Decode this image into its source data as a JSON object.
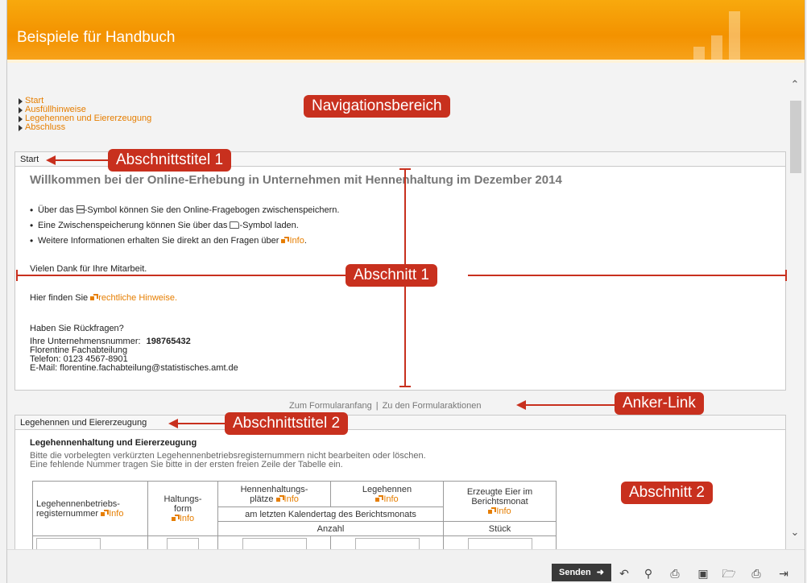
{
  "header": {
    "title": "Beispiele für Handbuch"
  },
  "nav": {
    "items": [
      "Start",
      "Ausfüllhinweise",
      "Legehennen und Eiererzeugung",
      "Abschluss"
    ]
  },
  "section1": {
    "heading": "Start",
    "welcome": "Willkommen bei der Online-Erhebung in Unternehmen mit Hennenhaltung im Dezember 2014",
    "bullet1_pre": "Über das ",
    "bullet1_post": "-Symbol können Sie den Online-Fragebogen zwischenspeichern.",
    "bullet2_pre": "Eine Zwischenspeicherung können Sie über das ",
    "bullet2_post": "-Symbol laden.",
    "bullet3_pre": "Weitere Informationen erhalten Sie direkt an den Fragen über ",
    "bullet3_link": "Info",
    "bullet3_post": ".",
    "thanks": "Vielen Dank für Ihre Mitarbeit.",
    "legal_pre": "Hier finden Sie ",
    "legal_link": "rechtliche Hinweise",
    "legal_post": ".",
    "questions": "Haben Sie Rückfragen?",
    "company_label": "Ihre Unternehmensnummer:",
    "company_number": "198765432",
    "contact_name": "Florentine Fachabteilung",
    "phone": "Telefon: 0123 4567-8901",
    "email": "E-Mail:   florentine.fachabteilung@statistisches.amt.de"
  },
  "anchors": {
    "top": "Zum Formularanfang",
    "separator": "|",
    "actions": "Zu den Formularaktionen"
  },
  "section2": {
    "heading": "Legehennen und Eiererzeugung",
    "title": "Legehennenhaltung und Eiererzeugung",
    "text_line1": "Bitte die vorbelegten verkürzten Legehennenbetriebsregisternummern nicht bearbeiten oder löschen.",
    "text_line2": "Eine fehlende Nummer tragen Sie bitte in der ersten freien Zeile der Tabelle ein.",
    "table": {
      "col1_line1": "Legehennenbetriebs-",
      "col1_line2": "registernummer",
      "col2_line1": "Haltungs-",
      "col2_line2": "form",
      "col3_line1": "Hennenhaltungs-",
      "col3_line2": "plätze",
      "col4": "Legehennen",
      "col5_line1": "Erzeugte Eier im",
      "col5_line2": "Berichtsmonat",
      "info": "Info",
      "subheader": "am letzten Kalendertag des Berichtsmonats",
      "unit_count": "Anzahl",
      "unit_pieces": "Stück"
    }
  },
  "annotations": {
    "nav": "Navigationsbereich",
    "title1": "Abschnittstitel 1",
    "section1": "Abschnitt 1",
    "anchor": "Anker-Link",
    "title2": "Abschnittstitel 2",
    "section2": "Abschnitt 2"
  },
  "toolbar": {
    "send_label": "Senden",
    "send_icon": "arrow-right-icon",
    "tools": [
      "undo-icon",
      "search-icon",
      "pdf-icon",
      "save-icon",
      "open-folder-icon",
      "print-icon",
      "exit-icon"
    ]
  },
  "colors": {
    "header": "#f39200",
    "accent": "#e67e00",
    "annotation": "#c8301e",
    "send_button": "#3a3a3a"
  }
}
